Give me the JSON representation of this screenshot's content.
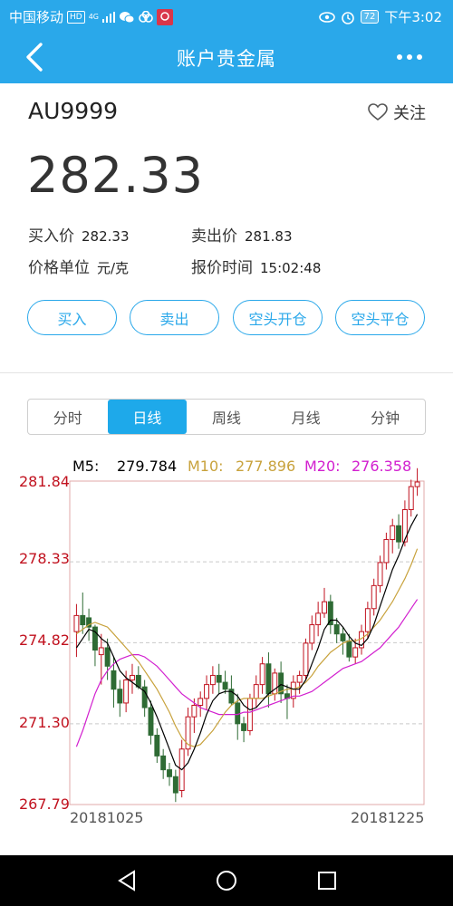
{
  "status_bar": {
    "carrier": "中国移动",
    "hd_badge": "HD",
    "network": "4G",
    "battery": "72",
    "time": "下午3:02"
  },
  "app_bar": {
    "title": "账户贵金属",
    "back_icon": "chevron-left-icon",
    "more_icon": "more-dots-icon"
  },
  "quote": {
    "symbol": "AU9999",
    "follow_label": "关注",
    "price": "282.33",
    "buy_price_label": "买入价",
    "buy_price": "282.33",
    "sell_price_label": "卖出价",
    "sell_price": "281.83",
    "unit_label": "价格单位",
    "unit": "元/克",
    "quote_time_label": "报价时间",
    "quote_time": "15:02:48"
  },
  "actions": {
    "buy": "买入",
    "sell": "卖出",
    "short_open": "空头开仓",
    "short_close": "空头平仓"
  },
  "tabs": [
    {
      "label": "分时",
      "active": false
    },
    {
      "label": "日线",
      "active": true
    },
    {
      "label": "周线",
      "active": false
    },
    {
      "label": "月线",
      "active": false
    },
    {
      "label": "分钟",
      "active": false
    }
  ],
  "ma_legend": {
    "m5_label": "M5:",
    "m5_value": "279.784",
    "m5_color": "#000000",
    "m10_label": "M10:",
    "m10_value": "277.896",
    "m10_color": "#c8a23c",
    "m20_label": "M20:",
    "m20_value": "276.358",
    "m20_color": "#d21fcf"
  },
  "colors": {
    "accent": "#2aa8ea",
    "up": "#c1121f",
    "down": "#2e6b34"
  },
  "chart_data": {
    "type": "candlestick",
    "y_ticks": [
      "281.84",
      "278.33",
      "274.82",
      "271.30",
      "267.79"
    ],
    "ylim": [
      267.79,
      281.84
    ],
    "x_start_label": "20181025",
    "x_end_label": "20181225",
    "candles": [
      [
        275.3,
        276.5,
        274.2,
        276.0
      ],
      [
        276.0,
        277.0,
        275.2,
        275.6
      ],
      [
        275.9,
        276.3,
        274.9,
        275.5
      ],
      [
        275.5,
        275.6,
        273.8,
        274.5
      ],
      [
        274.3,
        275.2,
        273.0,
        274.6
      ],
      [
        274.6,
        275.0,
        273.2,
        273.8
      ],
      [
        273.6,
        274.2,
        272.0,
        272.8
      ],
      [
        272.8,
        273.2,
        271.6,
        272.2
      ],
      [
        272.2,
        273.6,
        271.8,
        273.2
      ],
      [
        273.2,
        273.9,
        272.6,
        273.4
      ],
      [
        273.4,
        273.8,
        272.8,
        272.9
      ],
      [
        272.9,
        273.2,
        271.6,
        272.0
      ],
      [
        272.0,
        272.3,
        270.4,
        270.8
      ],
      [
        270.8,
        271.1,
        269.6,
        269.9
      ],
      [
        269.9,
        270.2,
        268.9,
        269.3
      ],
      [
        269.3,
        269.6,
        268.6,
        269.0
      ],
      [
        269.0,
        269.3,
        267.9,
        268.3
      ],
      [
        268.4,
        270.6,
        268.1,
        270.2
      ],
      [
        270.2,
        272.0,
        269.9,
        271.6
      ],
      [
        271.6,
        272.4,
        270.9,
        272.1
      ],
      [
        272.1,
        272.7,
        271.6,
        272.4
      ],
      [
        272.4,
        273.4,
        271.9,
        273.0
      ],
      [
        273.0,
        273.8,
        272.6,
        273.4
      ],
      [
        273.4,
        273.9,
        272.6,
        273.1
      ],
      [
        273.1,
        273.6,
        272.6,
        272.8
      ],
      [
        272.8,
        273.4,
        272.1,
        272.2
      ],
      [
        272.2,
        272.6,
        270.6,
        271.3
      ],
      [
        271.3,
        271.6,
        270.5,
        271.0
      ],
      [
        271.0,
        272.6,
        270.8,
        272.4
      ],
      [
        272.4,
        273.4,
        272.0,
        273.0
      ],
      [
        273.0,
        274.2,
        272.6,
        273.9
      ],
      [
        273.9,
        274.4,
        272.0,
        272.6
      ],
      [
        272.6,
        273.7,
        272.3,
        273.5
      ],
      [
        273.5,
        274.0,
        272.2,
        272.6
      ],
      [
        272.6,
        273.0,
        271.5,
        272.4
      ],
      [
        272.4,
        273.4,
        272.0,
        273.1
      ],
      [
        273.1,
        273.6,
        272.6,
        273.4
      ],
      [
        273.4,
        275.0,
        273.2,
        274.8
      ],
      [
        274.8,
        276.0,
        274.5,
        275.6
      ],
      [
        275.6,
        276.6,
        275.1,
        276.1
      ],
      [
        276.1,
        277.2,
        275.9,
        276.6
      ],
      [
        276.6,
        276.9,
        275.2,
        275.6
      ],
      [
        275.6,
        275.9,
        274.8,
        275.2
      ],
      [
        275.2,
        275.5,
        274.3,
        274.9
      ],
      [
        274.9,
        275.2,
        274.0,
        274.2
      ],
      [
        274.2,
        275.0,
        273.9,
        274.6
      ],
      [
        274.6,
        275.6,
        274.3,
        275.3
      ],
      [
        275.3,
        276.6,
        275.0,
        276.3
      ],
      [
        276.3,
        277.6,
        276.0,
        277.3
      ],
      [
        277.3,
        278.6,
        277.0,
        278.3
      ],
      [
        278.3,
        279.6,
        278.0,
        279.3
      ],
      [
        279.3,
        280.2,
        278.7,
        279.9
      ],
      [
        279.9,
        280.4,
        278.9,
        279.2
      ],
      [
        279.2,
        281.0,
        279.0,
        280.6
      ],
      [
        280.6,
        281.9,
        280.3,
        281.6
      ],
      [
        281.6,
        282.4,
        281.2,
        281.8
      ]
    ],
    "ma5": [
      274.6,
      275.0,
      275.4,
      275.3,
      275.0,
      274.8,
      274.2,
      273.6,
      273.3,
      273.1,
      272.9,
      272.7,
      272.2,
      271.6,
      270.9,
      270.2,
      269.5,
      269.3,
      269.6,
      270.2,
      270.9,
      271.7,
      272.3,
      272.6,
      272.7,
      272.7,
      272.5,
      272.1,
      271.9,
      272.0,
      272.3,
      272.6,
      272.8,
      273.0,
      272.9,
      272.8,
      272.8,
      273.2,
      273.9,
      274.6,
      275.4,
      275.8,
      275.8,
      275.5,
      275.1,
      274.8,
      274.7,
      275.0,
      275.6,
      276.4,
      277.2,
      278.0,
      278.6,
      279.3,
      279.9,
      280.4
    ],
    "ma10": [
      275.2,
      275.4,
      275.6,
      275.7,
      275.6,
      275.5,
      275.2,
      274.9,
      274.6,
      274.3,
      274.0,
      273.6,
      273.2,
      272.8,
      272.3,
      271.8,
      271.2,
      270.7,
      270.4,
      270.3,
      270.4,
      270.7,
      271.0,
      271.4,
      271.8,
      272.1,
      272.3,
      272.4,
      272.4,
      272.4,
      272.4,
      272.5,
      272.6,
      272.7,
      272.8,
      272.8,
      272.9,
      273.1,
      273.4,
      273.8,
      274.1,
      274.4,
      274.6,
      274.8,
      274.9,
      274.9,
      275.0,
      275.2,
      275.5,
      275.8,
      276.2,
      276.6,
      277.1,
      277.6,
      278.2,
      278.9
    ],
    "ma20": [
      270.3,
      271.0,
      271.8,
      272.6,
      273.2,
      273.6,
      273.9,
      274.1,
      274.2,
      274.3,
      274.3,
      274.2,
      274.0,
      273.8,
      273.5,
      273.2,
      272.9,
      272.6,
      272.4,
      272.2,
      272.0,
      271.9,
      271.8,
      271.7,
      271.7,
      271.7,
      271.7,
      271.8,
      271.8,
      271.9,
      272.0,
      272.1,
      272.2,
      272.3,
      272.4,
      272.5,
      272.5,
      272.6,
      272.7,
      272.9,
      273.1,
      273.3,
      273.5,
      273.7,
      273.8,
      273.9,
      274.0,
      274.2,
      274.4,
      274.6,
      274.9,
      275.2,
      275.5,
      275.9,
      276.3,
      276.7
    ]
  },
  "nav": {
    "back_icon": "triangle-back-icon",
    "home_icon": "circle-home-icon",
    "recents_icon": "square-recents-icon"
  }
}
